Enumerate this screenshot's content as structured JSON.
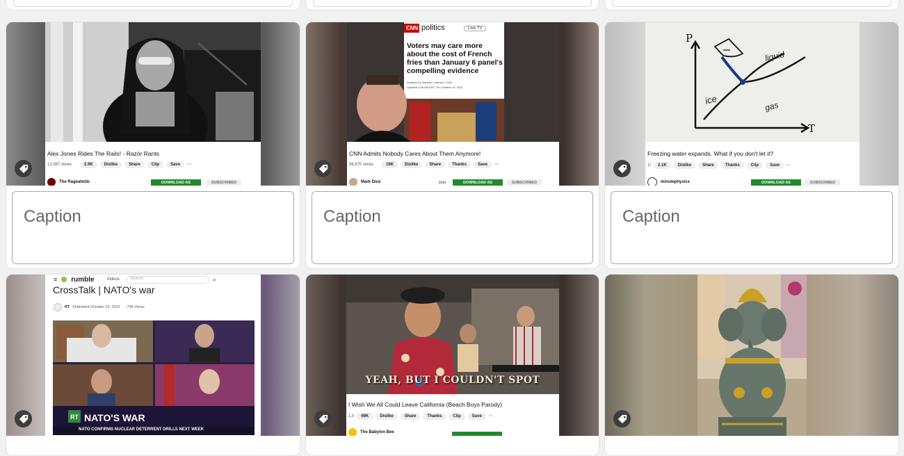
{
  "caption_placeholder": "Caption",
  "cards": [
    {
      "video_title": "Alex Jones Rides The Rails! - Razör Rants",
      "views": "12,087 views",
      "likes": "2.9K",
      "dislike": "Dislike",
      "share": "Share",
      "clip": "Clip",
      "save": "Save",
      "channel": "The Rageaholic",
      "download": "DOWNLOAD AS",
      "subscribed": "SUBSCRIBED"
    },
    {
      "brand": "CNN",
      "section": "politics",
      "live": "Live TV",
      "headline": "Voters may care more about the cost of French fries than January 6 panel's compelling evidence",
      "byline": "Analysis by Stephen Collinson, CNN",
      "updated": "Updated 9:48 AM EDT, Thu October 13, 2022",
      "video_title": "CNN Admits Nobody Cares About Them Anymore!",
      "views": "56,670 views",
      "likes": "16K",
      "dislike": "Dislike",
      "share": "Share",
      "thanks": "Thanks",
      "save": "Save",
      "channel": "Mark Dice",
      "join": "Join",
      "download": "DOWNLOAD AS",
      "subscribed": "SUBSCRIBED"
    },
    {
      "axis_p": "P",
      "axis_t": "T",
      "label_liquid": "liquid",
      "label_ice": "ice",
      "label_gas": "gas",
      "video_title": "Freezing water expands. What if you don't let it?",
      "views": "1!",
      "likes": "2.1K",
      "dislike": "Dislike",
      "share": "Share",
      "thanks": "Thanks",
      "clip": "Clip",
      "save": "Save",
      "channel": "minutephysics",
      "download": "DOWNLOAD AS",
      "subscribed": "SUBSCRIBED"
    },
    {
      "brand": "rumble",
      "videos": "Videos",
      "search": "Search",
      "video_title": "CrossTalk | NATO's war",
      "channel": "RT",
      "published": "Published October 14, 2022",
      "views": "794 Views",
      "lower_third": "NATO'S WAR",
      "ticker": "NATO CONFIRMS NUCLEAR DETERRENT DRILLS NEXT WEEK",
      "rt": "RT"
    },
    {
      "subtitle": "YEAH, BUT I COULDN'T SPOT",
      "video_title": "I Wish We All Could Leave California (Beach Boys Parody)",
      "views": "1,0",
      "likes": "69K",
      "dislike": "Dislike",
      "share": "Share",
      "thanks": "Thanks",
      "clip": "Clip",
      "save": "Save",
      "channel": "The Babylon Bee"
    },
    {}
  ]
}
